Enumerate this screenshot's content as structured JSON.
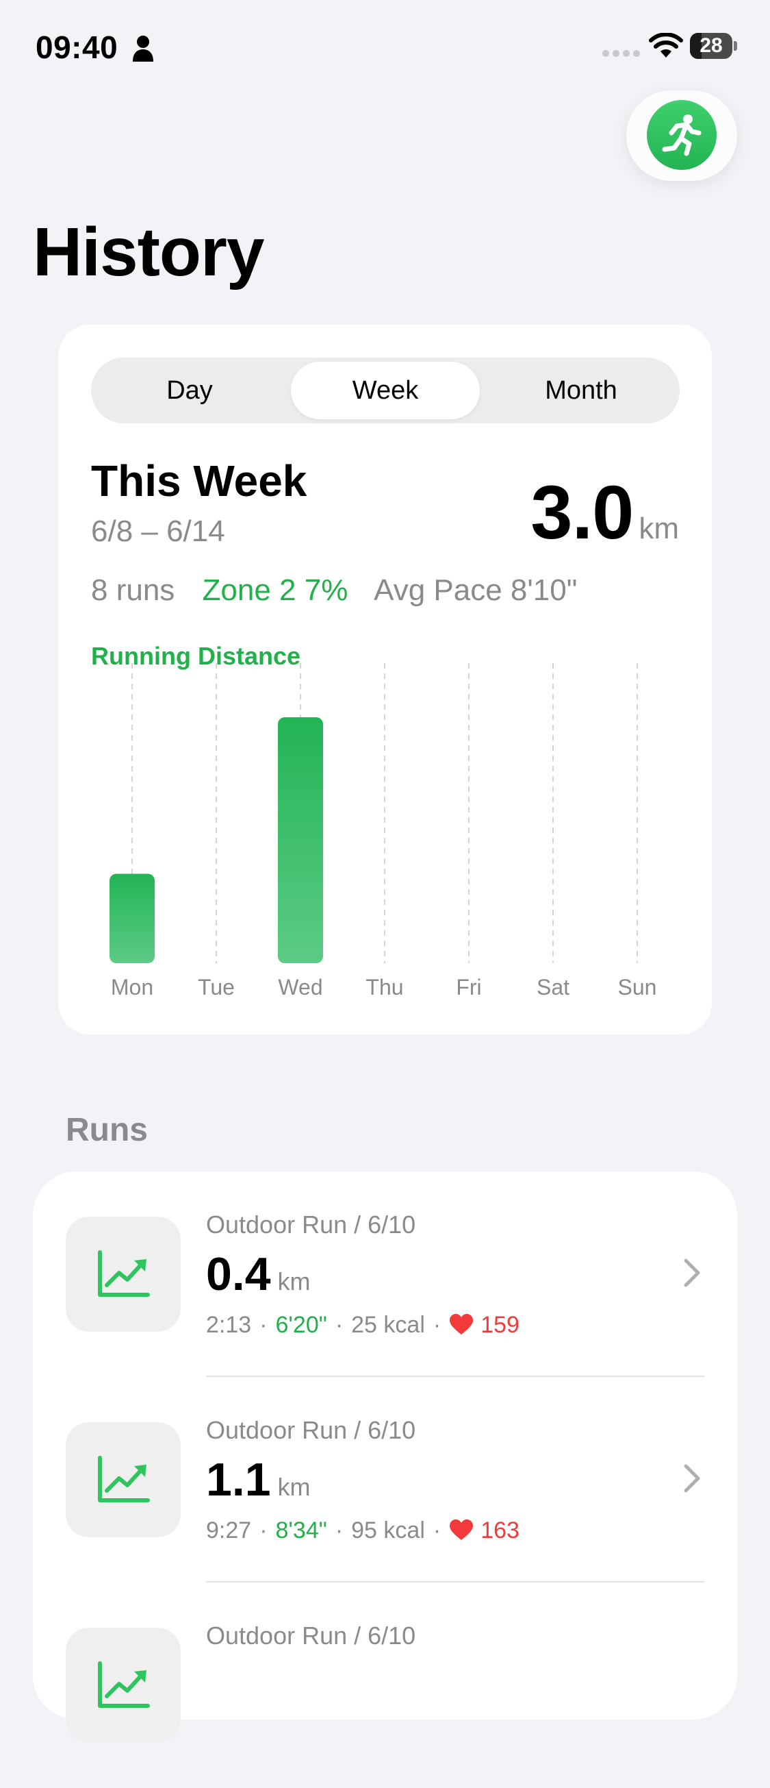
{
  "status_bar": {
    "time": "09:40",
    "battery": "28",
    "battery_level": 0.28
  },
  "page": {
    "title": "History"
  },
  "summary": {
    "tabs": [
      {
        "label": "Day",
        "selected": false
      },
      {
        "label": "Week",
        "selected": true
      },
      {
        "label": "Month",
        "selected": false
      }
    ],
    "period_title": "This Week",
    "date_range": "6/8 – 6/14",
    "total_distance": "3.0",
    "total_unit": "km",
    "runs_count": "8 runs",
    "zone_label": "Zone 2 7%",
    "avg_pace_label": "Avg Pace 8'10\""
  },
  "chart_data": {
    "type": "bar",
    "title": "Running Distance",
    "categories": [
      "Mon",
      "Tue",
      "Wed",
      "Thu",
      "Fri",
      "Sat",
      "Sun"
    ],
    "values": [
      0.8,
      0,
      2.2,
      0,
      0,
      0,
      0
    ],
    "ylim": [
      0,
      2.5
    ],
    "bar_color": "#23b455",
    "grid": "vertical dashed"
  },
  "runs": {
    "header": "Runs",
    "items": [
      {
        "title": "Outdoor Run / 6/10",
        "distance": "0.4",
        "unit": "km",
        "duration": "2:13",
        "pace": "6'20\"",
        "calories": "25 kcal",
        "heart_rate": "159"
      },
      {
        "title": "Outdoor Run / 6/10",
        "distance": "1.1",
        "unit": "km",
        "duration": "9:27",
        "pace": "8'34\"",
        "calories": "95 kcal",
        "heart_rate": "163"
      },
      {
        "title": "Outdoor Run / 6/10",
        "distance": "",
        "unit": "",
        "duration": "",
        "pace": "",
        "calories": "",
        "heart_rate": ""
      }
    ]
  },
  "colors": {
    "accent_green": "#22b04b",
    "heart_red": "#f23a3a",
    "background": "#f2f2f7"
  },
  "icons": [
    "person-icon",
    "wifi-icon",
    "battery-icon",
    "runner-icon",
    "trend-chart-icon",
    "heart-icon",
    "chevron-right-icon"
  ]
}
